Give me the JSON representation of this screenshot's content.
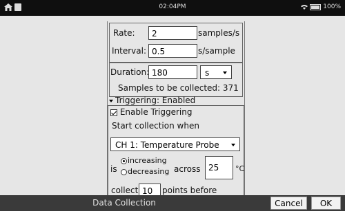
{
  "status_bar": {
    "time": "02:04PM",
    "battery": "100%"
  },
  "sampling": {
    "rate_label": "Rate:",
    "rate_value": "2",
    "rate_unit": "samples/s",
    "interval_label": "Interval:",
    "interval_value": "0.5",
    "interval_unit": "s/sample",
    "duration_label": "Duration:",
    "duration_value": "180",
    "duration_unit": "s",
    "samples_text": "Samples to be collected: 371"
  },
  "triggering": {
    "section_label": "Triggering: Enabled",
    "enable_label": "Enable Triggering",
    "start_label": "Start collection when",
    "sensor_selected": "CH 1: Temperature Probe",
    "is_label": "is",
    "increasing_label": "increasing",
    "decreasing_label": "decreasing",
    "across_label": "across",
    "threshold_value": "25",
    "threshold_unit": "°C",
    "collect_label": "collect",
    "points_value": "10",
    "points_suffix": "points before trigger."
  },
  "bottom_bar": {
    "title": "Data Collection",
    "cancel_label": "Cancel",
    "ok_label": "OK"
  }
}
